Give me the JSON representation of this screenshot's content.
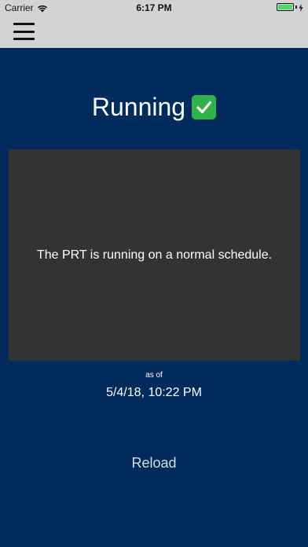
{
  "status_bar": {
    "carrier": "Carrier",
    "time": "6:17 PM",
    "battery_level": 1.0,
    "battery_color": "#4cd964"
  },
  "nav": {
    "menu_icon": "hamburger-menu-icon"
  },
  "main": {
    "status_label": "Running",
    "status_icon": "check-mark-icon",
    "message": "The PRT is running on a normal schedule.",
    "as_of_label": "as of",
    "timestamp": "5/4/18, 10:22 PM",
    "reload_label": "Reload"
  },
  "colors": {
    "background": "#002b5c",
    "top_bar": "#d2d3d5",
    "card": "#333333",
    "check": "#2fb24a"
  }
}
